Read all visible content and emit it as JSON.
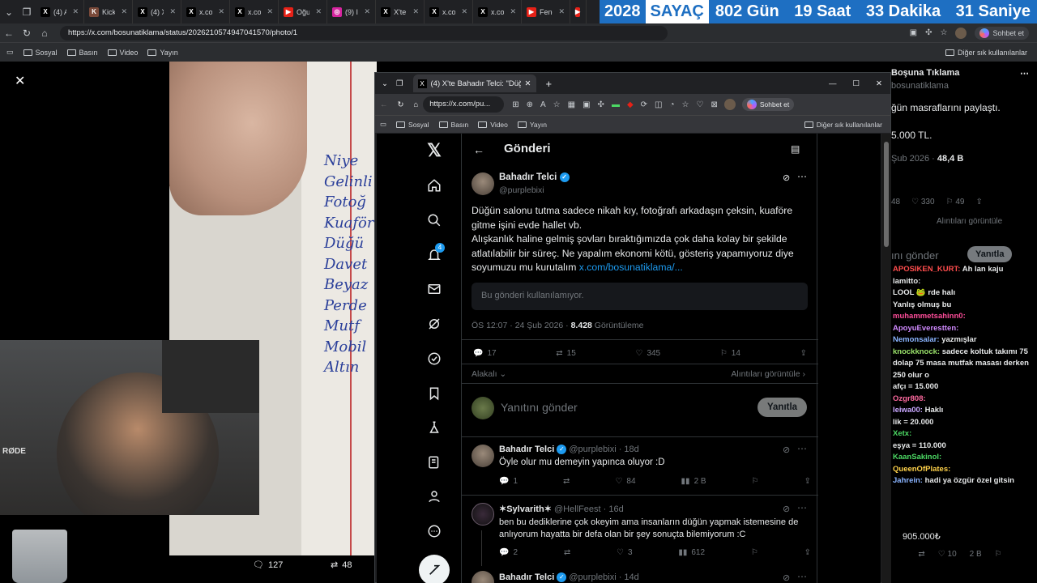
{
  "top_tabs": [
    {
      "label": "(4) An",
      "fav": "X",
      "color": "#000"
    },
    {
      "label": "KickPe",
      "fav": "K",
      "color": "#7a4a3a"
    },
    {
      "label": "(4) X'te",
      "fav": "X",
      "color": "#000"
    },
    {
      "label": "x.com/",
      "fav": "X",
      "color": "#000"
    },
    {
      "label": "x.com/",
      "fav": "X",
      "color": "#000"
    },
    {
      "label": "Oğuz",
      "fav": "▶",
      "color": "#e62117"
    },
    {
      "label": "(9) Ins",
      "fav": "◎",
      "color": "#d6249f"
    },
    {
      "label": "X'te lb",
      "fav": "X",
      "color": "#000"
    },
    {
      "label": "x.com/",
      "fav": "X",
      "color": "#000"
    },
    {
      "label": "x.com/",
      "fav": "X",
      "color": "#000"
    },
    {
      "label": "Fenerl",
      "fav": "▶",
      "color": "#e62117"
    },
    {
      "label": "F",
      "fav": "▶",
      "color": "#e62117"
    }
  ],
  "counter": {
    "year": "2028",
    "label": "SAYAÇ",
    "days": "802 Gün",
    "hours": "19 Saat",
    "minutes": "33 Dakika",
    "seconds": "31 Saniye"
  },
  "main_browser": {
    "url": "https://x.com/bosunatiklama/status/2026210574947041570/photo/1",
    "copilot": "Sohbet et"
  },
  "bookmarks": [
    "Sosyal",
    "Basın",
    "Video",
    "Yayın"
  ],
  "bookmarks_other": "Diğer sık kullanılanlar",
  "photo_stats": {
    "replies": "127",
    "reposts": "48"
  },
  "handwriting": [
    "Niye",
    "Gelinli",
    "Fotoğ",
    "Kuaför",
    "Düğü",
    "Davet",
    "Beyaz",
    "Perde",
    "Mutf",
    "Mobil",
    "Altın"
  ],
  "popup": {
    "tab_title": "(4) X'te Bahadır Telci: \"Düğün salon",
    "url": "https://x.com/pu...",
    "copilot": "Sohbet et",
    "bookmarks": [
      "Sosyal",
      "Basın",
      "Video",
      "Yayın"
    ],
    "bookmarks_other": "Diğer sık kullanılanlar"
  },
  "nav_badge": "4",
  "post": {
    "header": "Gönderi",
    "name": "Bahadır Telci",
    "handle": "@purplebixi",
    "text1": "Düğün salonu tutma sadece nikah kıy, fotoğrafı arkadaşın çeksin, kuaföre gitme işini evde hallet vb.",
    "text2": "Alışkanlık haline gelmiş şovları bıraktığımızda çok daha kolay bir şekilde atlatılabilir bir süreç. Ne yapalım ekonomi kötü, gösteriş yapamıyoruz diye soyumuzu mu kurutalım",
    "link": "x.com/bosunatiklama/...",
    "quote_unavailable": "Bu gönderi kullanılamıyor.",
    "time": "ÖS 12:07 · 24 Şub 2026 ·",
    "views": "8.428",
    "views_label": "Görüntüleme",
    "replies": "17",
    "reposts": "15",
    "likes": "345",
    "bookmarks": "14",
    "sort": "Alakalı",
    "quotes_link": "Alıntıları görüntüle",
    "reply_placeholder": "Yanıtını gönder",
    "reply_button": "Yanıtla"
  },
  "replies": [
    {
      "name": "Bahadır Telci",
      "handle": "@purplebixi · 18d",
      "text": "Öyle olur mu demeyin yapınca oluyor :D",
      "r": "1",
      "rt": "",
      "l": "84",
      "v": "2 B"
    },
    {
      "name": "✶Sylvarith✶",
      "handle": "@HellFeest · 16d",
      "text": "ben bu dediklerine çok okeyim ama insanların düğün yapmak istemesine de anlıyorum hayatta bir defa olan bir şey sonuçta bilemiyorum :C",
      "r": "2",
      "rt": "",
      "l": "3",
      "v": "612"
    },
    {
      "name": "Bahadır Telci",
      "handle": "@purplebixi · 14d",
      "text": ""
    }
  ],
  "right_panel": {
    "title": "Boşuna Tıklama",
    "handle": "bosunatiklama",
    "text1": "ğün masraflarını paylaştı.",
    "text2": "5.000 TL.",
    "date": "Şub 2026 ·",
    "views": "48,4 B",
    "likes": "330",
    "bm": "49",
    "rep": "48",
    "quotes": "Alıntıları görüntüle",
    "reply_ph": "ını gönder",
    "reply_btn": "Yanıtla",
    "chat": [
      {
        "u": "APOSIKEN_KURT:",
        "m": "Ah lan kaju",
        "c": "#ff4d4d"
      },
      {
        "u": "lamitto:",
        "m": "",
        "c": "#e7e9ea"
      },
      {
        "u": "",
        "m": "LOOL 🐸 rde halı",
        "c": "#e7e9ea"
      },
      {
        "u": "",
        "m": "Yanlış olmuş bu",
        "c": "#e7e9ea"
      },
      {
        "u": "muhammetsahinn0:",
        "m": "",
        "c": "#ff4d9a"
      },
      {
        "u": "ApoyuEverestten:",
        "m": "",
        "c": "#d08aff"
      },
      {
        "u": "Nemonsalar:",
        "m": "yazmışlar",
        "c": "#8ab4ff"
      },
      {
        "u": "knockknock:",
        "m": "sadece koltuk takımı 75 dolap 75 masa mutfak masası derken 250 olur o",
        "c": "#9be36b"
      },
      {
        "u": "",
        "m": "afçı = 15.000",
        "c": "#e7e9ea"
      },
      {
        "u": "Ozgr808:",
        "m": "",
        "c": "#ff6aa0"
      },
      {
        "u": "leiwa00:",
        "m": "Haklı",
        "c": "#c9a8ff"
      },
      {
        "u": "",
        "m": "lik = 20.000",
        "c": "#e7e9ea"
      },
      {
        "u": "Xetx:",
        "m": "",
        "c": "#4cd964"
      },
      {
        "u": "",
        "m": "eşya = 110.000",
        "c": "#e7e9ea"
      },
      {
        "u": "KaanSakinol:",
        "m": "",
        "c": "#4cd964"
      },
      {
        "u": "QueenOfPlates:",
        "m": "",
        "c": "#ffd24a"
      },
      {
        "u": "Jahrein:",
        "m": "hadi ya özgür özel gitsin",
        "c": "#8ab4ff"
      }
    ],
    "total": "905.000₺",
    "bottom": {
      "likes": "10",
      "views": "2 B"
    }
  }
}
